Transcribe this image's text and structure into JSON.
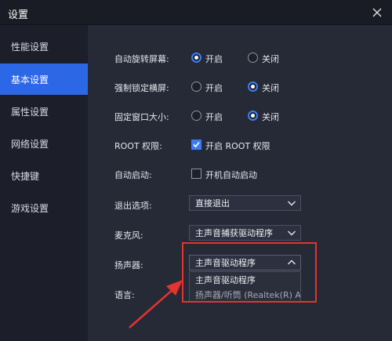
{
  "window": {
    "title": "设置"
  },
  "sidebar": {
    "items": [
      {
        "label": "性能设置"
      },
      {
        "label": "基本设置"
      },
      {
        "label": "属性设置"
      },
      {
        "label": "网络设置"
      },
      {
        "label": "快捷键"
      },
      {
        "label": "游戏设置"
      }
    ],
    "active": "基本设置"
  },
  "settings": {
    "auto_rotate": {
      "label": "自动旋转屏幕:",
      "options": [
        "开启",
        "关闭"
      ],
      "selected": "开启"
    },
    "force_landscape": {
      "label": "强制锁定横屏:",
      "options": [
        "开启",
        "关闭"
      ],
      "selected": "关闭"
    },
    "fixed_window": {
      "label": "固定窗口大小:",
      "options": [
        "开启",
        "关闭"
      ],
      "selected": "关闭"
    },
    "root": {
      "label": "ROOT 权限:",
      "checkbox_label": "开启 ROOT 权限",
      "checked": true
    },
    "autostart": {
      "label": "自动启动:",
      "checkbox_label": "开机自动启动",
      "checked": false
    },
    "exit": {
      "label": "退出选项:",
      "value": "直接退出"
    },
    "microphone": {
      "label": "麦克风:",
      "value": "主声音捕获驱动程序"
    },
    "speaker": {
      "label": "扬声器:",
      "value": "主声音驱动程序",
      "options": [
        "主声音驱动程序",
        "扬声器/听筒 (Realtek(R) Au"
      ]
    },
    "language": {
      "label": "语言:"
    }
  },
  "colors": {
    "accent": "#2c67e6",
    "highlight": "#e5332f"
  }
}
